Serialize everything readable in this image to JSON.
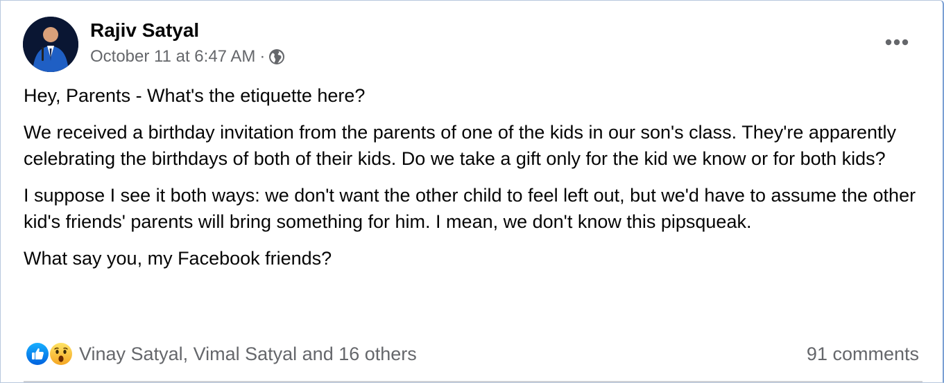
{
  "post": {
    "author": "Rajiv Satyal",
    "timestamp": "October 11 at 6:47 AM",
    "separator": "·",
    "audience_icon": "globe-icon",
    "more_icon": "ellipsis-icon",
    "paragraphs": [
      "Hey, Parents - What's the etiquette here?",
      "We received a birthday invitation from the parents of one of the kids in our son's class.  They're apparently celebrating the birthdays of both of their kids.  Do we take a gift only for the kid we know or for both kids?",
      "I suppose I see it both ways:  we don't want the other child to feel left out, but we'd have to assume the other kid's friends' parents will bring something for him.  I mean, we don't know this pipsqueak.",
      "What say you, my Facebook friends?"
    ],
    "reactions": {
      "icons": [
        "like-icon",
        "wow-icon"
      ],
      "text": "Vinay Satyal, Vimal Satyal and 16 others"
    },
    "comments": "91 comments"
  },
  "colors": {
    "secondary_text": "#65676b",
    "like_blue": "#1877f2",
    "wow_yellow": "#f7b928",
    "card_border": "#7a9fd3"
  }
}
